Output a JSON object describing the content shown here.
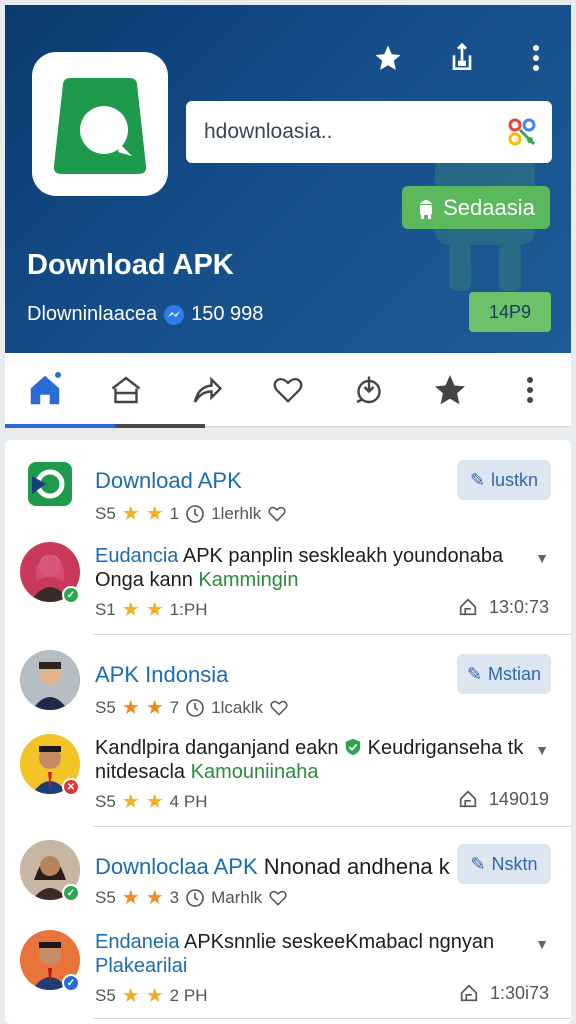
{
  "header": {
    "app_title": "Download APK",
    "subtitle": "Dlowninlaacea",
    "downloads": "150 998",
    "search_value": "hdownloasia..",
    "green_chip": "Sedaasia",
    "version_button": "14P9",
    "colors": {
      "bg": "#134a86",
      "green": "#5cb85c",
      "accent": "#2b6cd4"
    }
  },
  "top_actions": [
    {
      "icon": "star-icon"
    },
    {
      "icon": "share-icon"
    },
    {
      "icon": "more-vert-icon"
    }
  ],
  "tabs": [
    {
      "icon": "home-icon",
      "active": true
    },
    {
      "icon": "house-outline-icon"
    },
    {
      "icon": "forward-arrow-icon"
    },
    {
      "icon": "heart-icon"
    },
    {
      "icon": "download-icon"
    },
    {
      "icon": "star-icon"
    },
    {
      "icon": "more-vert-icon"
    }
  ],
  "feed": {
    "post1": {
      "title": "Download APK",
      "button": "lustkn",
      "meta_prefix": "S5",
      "meta_count": "1",
      "meta_label": "1lerhlk"
    },
    "comment1": {
      "name": "Eudancia",
      "text_a": " APK panplin seskleakh youndonaba",
      "text_b": "Onga kann ",
      "text_c": "Kammingin",
      "meta_prefix": "S1",
      "meta_time": "1:PH",
      "right_time": "13:0:73"
    },
    "post2": {
      "title": "APK Indonsia",
      "button": "Mstian",
      "meta_prefix": "S5",
      "meta_count": "7",
      "meta_label": "1lcaklk"
    },
    "comment2": {
      "text_a": "Kandlpira danganjand eakn ",
      "text_b": " Keudriganseha tk",
      "text_c": "nitdesacla ",
      "text_d": "Kamouniinaha",
      "meta_prefix": "S5",
      "meta_time": "4 PH",
      "right_time": "149019"
    },
    "post3": {
      "title_a": "Downloclaa APK ",
      "title_b": "Nnonad andhena k",
      "button": "Nsktn",
      "meta_prefix": "S5",
      "meta_count": "3",
      "meta_label": "Marhlk"
    },
    "comment3": {
      "name": "Endaneia",
      "text_a": " APKsnnlie seskeeKmabacl ngnyan",
      "text_b": "Plakearilai",
      "meta_prefix": "S5",
      "meta_time": "2 PH",
      "right_time": "1:30i73"
    }
  }
}
